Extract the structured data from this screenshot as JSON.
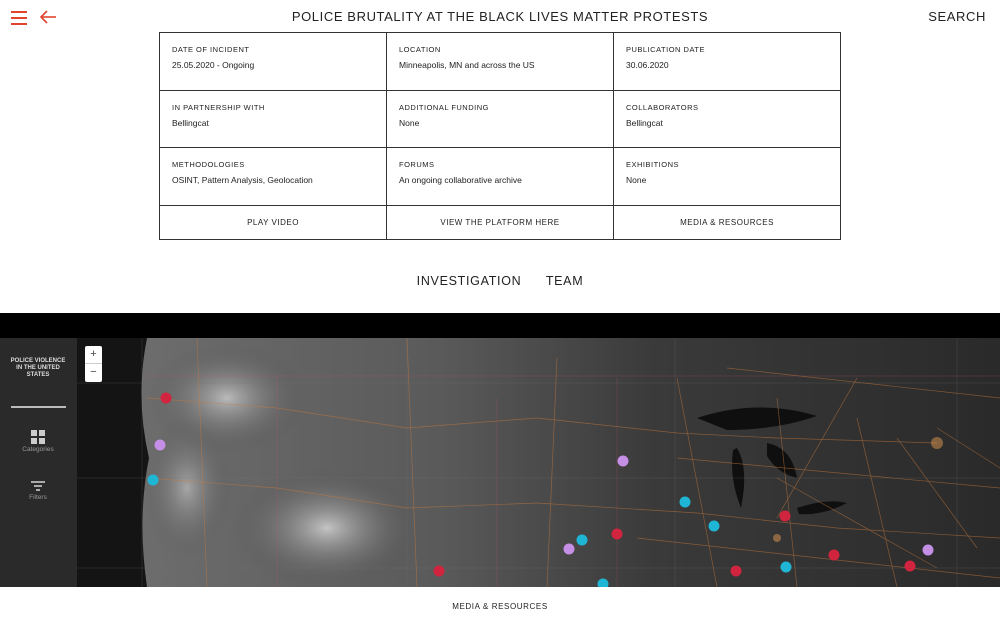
{
  "header": {
    "title": "POLICE BRUTALITY AT THE BLACK LIVES MATTER PROTESTS",
    "search_label": "SEARCH",
    "menu_icon": "hamburger-icon",
    "back_icon": "arrow-left-icon",
    "accent_color": "#e0442e"
  },
  "info": {
    "date_label": "DATE OF INCIDENT",
    "date_value": "25.05.2020 - Ongoing",
    "location_label": "LOCATION",
    "location_value": "Minneapolis, MN and across the US",
    "publication_label": "PUBLICATION DATE",
    "publication_value": "30.06.2020",
    "partnership_label": "IN PARTNERSHIP WITH",
    "partnership_value": "Bellingcat",
    "funding_label": "ADDITIONAL FUNDING",
    "funding_value": "None",
    "collaborators_label": "COLLABORATORS",
    "collaborators_value": "Bellingcat",
    "methodologies_label": "METHODOLOGIES",
    "methodologies_value": "OSINT, Pattern Analysis, Geolocation",
    "forums_label": "FORUMS",
    "forums_value": "An ongoing collaborative archive",
    "exhibitions_label": "EXHIBITIONS",
    "exhibitions_value": "None"
  },
  "actions": {
    "play_video": "PLAY VIDEO",
    "view_platform": "VIEW THE PLATFORM HERE",
    "media_resources": "MEDIA & RESOURCES"
  },
  "tabs": [
    {
      "label": "INVESTIGATION"
    },
    {
      "label": "TEAM"
    }
  ],
  "map": {
    "side_title": "POLICE VIOLENCE IN THE UNITED STATES",
    "categories_label": "Categories",
    "filters_label": "Filters",
    "zoom_in": "+",
    "zoom_out": "−",
    "marker_colors": {
      "red": "#d0243f",
      "cyan": "#1fb6d6",
      "lilac": "#c58fe6"
    }
  },
  "footer": {
    "media_resources": "MEDIA & RESOURCES"
  }
}
